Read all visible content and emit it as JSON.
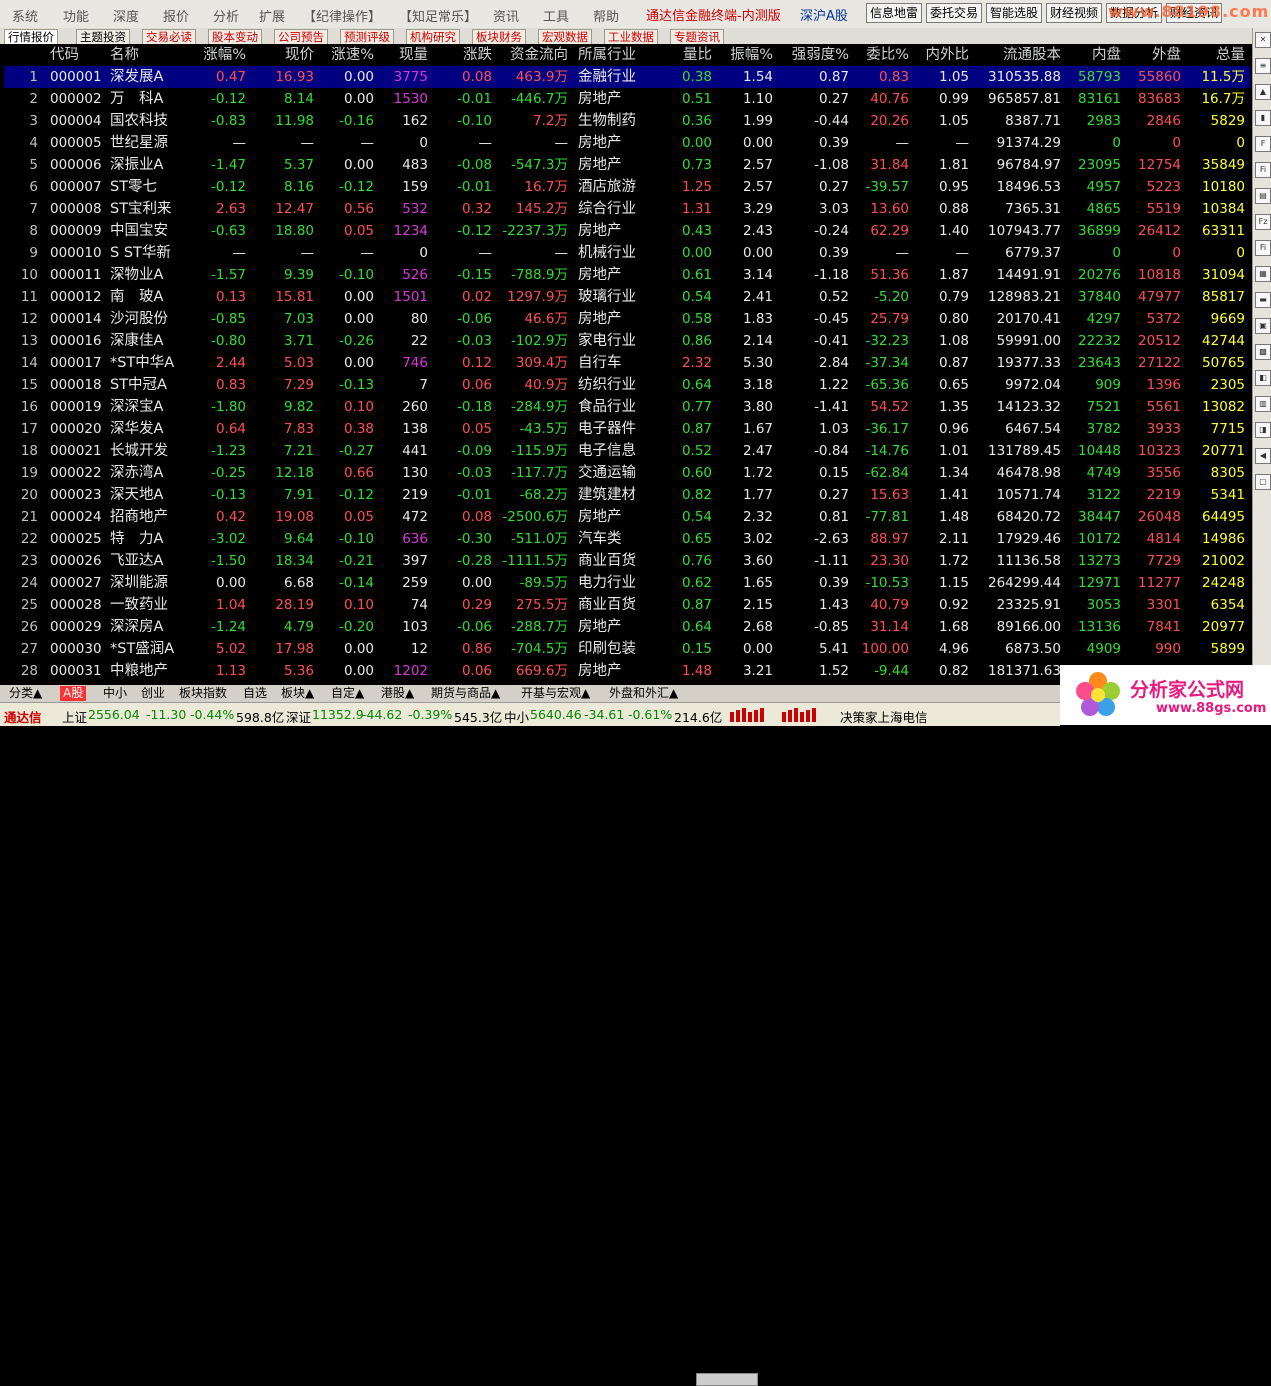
{
  "menu": [
    "系统",
    "功能",
    "深度",
    "报价",
    "分析",
    "扩展",
    "【纪律操作】",
    "【知足常乐】",
    "资讯",
    "工具",
    "帮助"
  ],
  "app_title": "通达信金融终端-内测版",
  "board_title": "深沪A股",
  "top_buttons": [
    "信息地雷",
    "委托交易",
    "智能选股",
    "财经视频",
    "数据分析",
    "财经资讯"
  ],
  "watermark": "www.88198.com",
  "tabs": [
    "行情报价",
    "主题投资",
    "交易必读",
    "股本变动",
    "公司预告",
    "预测评级",
    "机构研究",
    "板块财务",
    "宏观数据",
    "工业数据",
    "专题资讯"
  ],
  "columns": [
    "代码",
    "名称",
    "涨幅%",
    "现价",
    "涨速%",
    "现量",
    "涨跌",
    "资金流向",
    "所属行业",
    "量比",
    "振幅%",
    "强弱度%",
    "委比%",
    "内外比",
    "流通股本",
    "内盘",
    "外盘",
    "总量"
  ],
  "rows": [
    {
      "idx": "1",
      "code": "000001",
      "name": "深发展A",
      "chg": "0.47",
      "price": "16.93",
      "spd": "0.00",
      "vol": "3775",
      "diff": "0.08",
      "flow": "463.9万",
      "ind": "金融行业",
      "vr": "0.38",
      "amp": "1.54",
      "str": "0.87",
      "wb": "0.83",
      "io": "1.05",
      "cap": "310535.88",
      "inn": "58793",
      "out": "55860",
      "tot": "11.5万"
    },
    {
      "idx": "2",
      "code": "000002",
      "name": "万　科A",
      "chg": "-0.12",
      "price": "8.14",
      "spd": "0.00",
      "vol": "1530",
      "diff": "-0.01",
      "flow": "-446.7万",
      "ind": "房地产",
      "vr": "0.51",
      "amp": "1.10",
      "str": "0.27",
      "wb": "40.76",
      "io": "0.99",
      "cap": "965857.81",
      "inn": "83161",
      "out": "83683",
      "tot": "16.7万"
    },
    {
      "idx": "3",
      "code": "000004",
      "name": "国农科技",
      "chg": "-0.83",
      "price": "11.98",
      "spd": "-0.16",
      "vol": "162",
      "diff": "-0.10",
      "flow": "7.2万",
      "ind": "生物制药",
      "vr": "0.36",
      "amp": "1.99",
      "str": "-0.44",
      "wb": "20.26",
      "io": "1.05",
      "cap": "8387.71",
      "inn": "2983",
      "out": "2846",
      "tot": "5829"
    },
    {
      "idx": "4",
      "code": "000005",
      "name": "世纪星源",
      "chg": "—",
      "price": "—",
      "spd": "—",
      "vol": "0",
      "diff": "—",
      "flow": "—",
      "ind": "房地产",
      "vr": "0.00",
      "amp": "0.00",
      "str": "0.39",
      "wb": "—",
      "io": "—",
      "cap": "91374.29",
      "inn": "0",
      "out": "0",
      "tot": "0"
    },
    {
      "idx": "5",
      "code": "000006",
      "name": "深振业A",
      "chg": "-1.47",
      "price": "5.37",
      "spd": "0.00",
      "vol": "483",
      "diff": "-0.08",
      "flow": "-547.3万",
      "ind": "房地产",
      "vr": "0.73",
      "amp": "2.57",
      "str": "-1.08",
      "wb": "31.84",
      "io": "1.81",
      "cap": "96784.97",
      "inn": "23095",
      "out": "12754",
      "tot": "35849"
    },
    {
      "idx": "6",
      "code": "000007",
      "name": "ST零七",
      "chg": "-0.12",
      "price": "8.16",
      "spd": "-0.12",
      "vol": "159",
      "diff": "-0.01",
      "flow": "16.7万",
      "ind": "酒店旅游",
      "vr": "1.25",
      "amp": "2.57",
      "str": "0.27",
      "wb": "-39.57",
      "io": "0.95",
      "cap": "18496.53",
      "inn": "4957",
      "out": "5223",
      "tot": "10180"
    },
    {
      "idx": "7",
      "code": "000008",
      "name": "ST宝利来",
      "chg": "2.63",
      "price": "12.47",
      "spd": "0.56",
      "vol": "532",
      "diff": "0.32",
      "flow": "145.2万",
      "ind": "综合行业",
      "vr": "1.31",
      "amp": "3.29",
      "str": "3.03",
      "wb": "13.60",
      "io": "0.88",
      "cap": "7365.31",
      "inn": "4865",
      "out": "5519",
      "tot": "10384"
    },
    {
      "idx": "8",
      "code": "000009",
      "name": "中国宝安",
      "chg": "-0.63",
      "price": "18.80",
      "spd": "0.05",
      "vol": "1234",
      "diff": "-0.12",
      "flow": "-2237.3万",
      "ind": "房地产",
      "vr": "0.43",
      "amp": "2.43",
      "str": "-0.24",
      "wb": "62.29",
      "io": "1.40",
      "cap": "107943.77",
      "inn": "36899",
      "out": "26412",
      "tot": "63311"
    },
    {
      "idx": "9",
      "code": "000010",
      "name": "S ST华新",
      "chg": "—",
      "price": "—",
      "spd": "—",
      "vol": "0",
      "diff": "—",
      "flow": "—",
      "ind": "机械行业",
      "vr": "0.00",
      "amp": "0.00",
      "str": "0.39",
      "wb": "—",
      "io": "—",
      "cap": "6779.37",
      "inn": "0",
      "out": "0",
      "tot": "0"
    },
    {
      "idx": "10",
      "code": "000011",
      "name": "深物业A",
      "chg": "-1.57",
      "price": "9.39",
      "spd": "-0.10",
      "vol": "526",
      "diff": "-0.15",
      "flow": "-788.9万",
      "ind": "房地产",
      "vr": "0.61",
      "amp": "3.14",
      "str": "-1.18",
      "wb": "51.36",
      "io": "1.87",
      "cap": "14491.91",
      "inn": "20276",
      "out": "10818",
      "tot": "31094"
    },
    {
      "idx": "11",
      "code": "000012",
      "name": "南　玻A",
      "chg": "0.13",
      "price": "15.81",
      "spd": "0.00",
      "vol": "1501",
      "diff": "0.02",
      "flow": "1297.9万",
      "ind": "玻璃行业",
      "vr": "0.54",
      "amp": "2.41",
      "str": "0.52",
      "wb": "-5.20",
      "io": "0.79",
      "cap": "128983.21",
      "inn": "37840",
      "out": "47977",
      "tot": "85817"
    },
    {
      "idx": "12",
      "code": "000014",
      "name": "沙河股份",
      "chg": "-0.85",
      "price": "7.03",
      "spd": "0.00",
      "vol": "80",
      "diff": "-0.06",
      "flow": "46.6万",
      "ind": "房地产",
      "vr": "0.58",
      "amp": "1.83",
      "str": "-0.45",
      "wb": "25.79",
      "io": "0.80",
      "cap": "20170.41",
      "inn": "4297",
      "out": "5372",
      "tot": "9669"
    },
    {
      "idx": "13",
      "code": "000016",
      "name": "深康佳A",
      "chg": "-0.80",
      "price": "3.71",
      "spd": "-0.26",
      "vol": "22",
      "diff": "-0.03",
      "flow": "-102.9万",
      "ind": "家电行业",
      "vr": "0.86",
      "amp": "2.14",
      "str": "-0.41",
      "wb": "-32.23",
      "io": "1.08",
      "cap": "59991.00",
      "inn": "22232",
      "out": "20512",
      "tot": "42744"
    },
    {
      "idx": "14",
      "code": "000017",
      "name": "*ST中华A",
      "chg": "2.44",
      "price": "5.03",
      "spd": "0.00",
      "vol": "746",
      "diff": "0.12",
      "flow": "309.4万",
      "ind": "自行车",
      "vr": "2.32",
      "amp": "5.30",
      "str": "2.84",
      "wb": "-37.34",
      "io": "0.87",
      "cap": "19377.33",
      "inn": "23643",
      "out": "27122",
      "tot": "50765"
    },
    {
      "idx": "15",
      "code": "000018",
      "name": "ST中冠A",
      "chg": "0.83",
      "price": "7.29",
      "spd": "-0.13",
      "vol": "7",
      "diff": "0.06",
      "flow": "40.9万",
      "ind": "纺织行业",
      "vr": "0.64",
      "amp": "3.18",
      "str": "1.22",
      "wb": "-65.36",
      "io": "0.65",
      "cap": "9972.04",
      "inn": "909",
      "out": "1396",
      "tot": "2305"
    },
    {
      "idx": "16",
      "code": "000019",
      "name": "深深宝A",
      "chg": "-1.80",
      "price": "9.82",
      "spd": "0.10",
      "vol": "260",
      "diff": "-0.18",
      "flow": "-284.9万",
      "ind": "食品行业",
      "vr": "0.77",
      "amp": "3.80",
      "str": "-1.41",
      "wb": "54.52",
      "io": "1.35",
      "cap": "14123.32",
      "inn": "7521",
      "out": "5561",
      "tot": "13082"
    },
    {
      "idx": "17",
      "code": "000020",
      "name": "深华发A",
      "chg": "0.64",
      "price": "7.83",
      "spd": "0.38",
      "vol": "138",
      "diff": "0.05",
      "flow": "-43.5万",
      "ind": "电子器件",
      "vr": "0.87",
      "amp": "1.67",
      "str": "1.03",
      "wb": "-36.17",
      "io": "0.96",
      "cap": "6467.54",
      "inn": "3782",
      "out": "3933",
      "tot": "7715"
    },
    {
      "idx": "18",
      "code": "000021",
      "name": "长城开发",
      "chg": "-1.23",
      "price": "7.21",
      "spd": "-0.27",
      "vol": "441",
      "diff": "-0.09",
      "flow": "-115.9万",
      "ind": "电子信息",
      "vr": "0.52",
      "amp": "2.47",
      "str": "-0.84",
      "wb": "-14.76",
      "io": "1.01",
      "cap": "131789.45",
      "inn": "10448",
      "out": "10323",
      "tot": "20771"
    },
    {
      "idx": "19",
      "code": "000022",
      "name": "深赤湾A",
      "chg": "-0.25",
      "price": "12.18",
      "spd": "0.66",
      "vol": "130",
      "diff": "-0.03",
      "flow": "-117.7万",
      "ind": "交通运输",
      "vr": "0.60",
      "amp": "1.72",
      "str": "0.15",
      "wb": "-62.84",
      "io": "1.34",
      "cap": "46478.98",
      "inn": "4749",
      "out": "3556",
      "tot": "8305"
    },
    {
      "idx": "20",
      "code": "000023",
      "name": "深天地A",
      "chg": "-0.13",
      "price": "7.91",
      "spd": "-0.12",
      "vol": "219",
      "diff": "-0.01",
      "flow": "-68.2万",
      "ind": "建筑建材",
      "vr": "0.82",
      "amp": "1.77",
      "str": "0.27",
      "wb": "15.63",
      "io": "1.41",
      "cap": "10571.74",
      "inn": "3122",
      "out": "2219",
      "tot": "5341"
    },
    {
      "idx": "21",
      "code": "000024",
      "name": "招商地产",
      "chg": "0.42",
      "price": "19.08",
      "spd": "0.05",
      "vol": "472",
      "diff": "0.08",
      "flow": "-2500.6万",
      "ind": "房地产",
      "vr": "0.54",
      "amp": "2.32",
      "str": "0.81",
      "wb": "-77.81",
      "io": "1.48",
      "cap": "68420.72",
      "inn": "38447",
      "out": "26048",
      "tot": "64495"
    },
    {
      "idx": "22",
      "code": "000025",
      "name": "特　力A",
      "chg": "-3.02",
      "price": "9.64",
      "spd": "-0.10",
      "vol": "636",
      "diff": "-0.30",
      "flow": "-511.0万",
      "ind": "汽车类",
      "vr": "0.65",
      "amp": "3.02",
      "str": "-2.63",
      "wb": "88.97",
      "io": "2.11",
      "cap": "17929.46",
      "inn": "10172",
      "out": "4814",
      "tot": "14986"
    },
    {
      "idx": "23",
      "code": "000026",
      "name": "飞亚达A",
      "chg": "-1.50",
      "price": "18.34",
      "spd": "-0.21",
      "vol": "397",
      "diff": "-0.28",
      "flow": "-1111.5万",
      "ind": "商业百货",
      "vr": "0.76",
      "amp": "3.60",
      "str": "-1.11",
      "wb": "23.30",
      "io": "1.72",
      "cap": "11136.58",
      "inn": "13273",
      "out": "7729",
      "tot": "21002"
    },
    {
      "idx": "24",
      "code": "000027",
      "name": "深圳能源",
      "chg": "0.00",
      "price": "6.68",
      "spd": "-0.14",
      "vol": "259",
      "diff": "0.00",
      "flow": "-89.5万",
      "ind": "电力行业",
      "vr": "0.62",
      "amp": "1.65",
      "str": "0.39",
      "wb": "-10.53",
      "io": "1.15",
      "cap": "264299.44",
      "inn": "12971",
      "out": "11277",
      "tot": "24248"
    },
    {
      "idx": "25",
      "code": "000028",
      "name": "一致药业",
      "chg": "1.04",
      "price": "28.19",
      "spd": "0.10",
      "vol": "74",
      "diff": "0.29",
      "flow": "275.5万",
      "ind": "商业百货",
      "vr": "0.87",
      "amp": "2.15",
      "str": "1.43",
      "wb": "40.79",
      "io": "0.92",
      "cap": "23325.91",
      "inn": "3053",
      "out": "3301",
      "tot": "6354"
    },
    {
      "idx": "26",
      "code": "000029",
      "name": "深深房A",
      "chg": "-1.24",
      "price": "4.79",
      "spd": "-0.20",
      "vol": "103",
      "diff": "-0.06",
      "flow": "-288.7万",
      "ind": "房地产",
      "vr": "0.64",
      "amp": "2.68",
      "str": "-0.85",
      "wb": "31.14",
      "io": "1.68",
      "cap": "89166.00",
      "inn": "13136",
      "out": "7841",
      "tot": "20977"
    },
    {
      "idx": "27",
      "code": "000030",
      "name": "*ST盛润A",
      "chg": "5.02",
      "price": "17.98",
      "spd": "0.00",
      "vol": "12",
      "diff": "0.86",
      "flow": "-704.5万",
      "ind": "印刷包装",
      "vr": "0.15",
      "amp": "0.00",
      "str": "5.41",
      "wb": "100.00",
      "io": "4.96",
      "cap": "6873.50",
      "inn": "4909",
      "out": "990",
      "tot": "5899"
    },
    {
      "idx": "28",
      "code": "000031",
      "name": "中粮地产",
      "chg": "1.13",
      "price": "5.36",
      "spd": "0.00",
      "vol": "1202",
      "diff": "0.06",
      "flow": "669.6万",
      "ind": "房地产",
      "vr": "1.48",
      "amp": "3.21",
      "str": "1.52",
      "wb": "-9.44",
      "io": "0.82",
      "cap": "181371.63",
      "inn": "",
      "out": "",
      "tot": ""
    }
  ],
  "bottom_tabs": [
    "分类▲",
    "A股",
    "中小",
    "创业",
    "板块指数",
    "自选",
    "板块▲",
    "自定▲",
    "港股▲",
    "期货与商品▲",
    "开基与宏观▲",
    "外盘和外汇▲"
  ],
  "status": {
    "brand": "通达信",
    "sh_label": "上证",
    "sh_idx": "2556.04",
    "sh_chg": "-11.30",
    "sh_pct": "-0.44%",
    "sh_amt": "598.8亿",
    "sz_label": "深证",
    "sz_idx": "11352.9",
    "sz_chg": "-44.62",
    "sz_pct": "-0.39%",
    "sz_amt": "545.3亿",
    "zx_label": "中小",
    "zx_idx": "5640.46",
    "zx_chg": "-34.61",
    "zx_pct": "-0.61%",
    "zx_amt": "214.6亿",
    "feed": "决策家上海电信"
  },
  "brand_logo": {
    "text": "分析家公式网",
    "url": "www.88gs.com"
  }
}
